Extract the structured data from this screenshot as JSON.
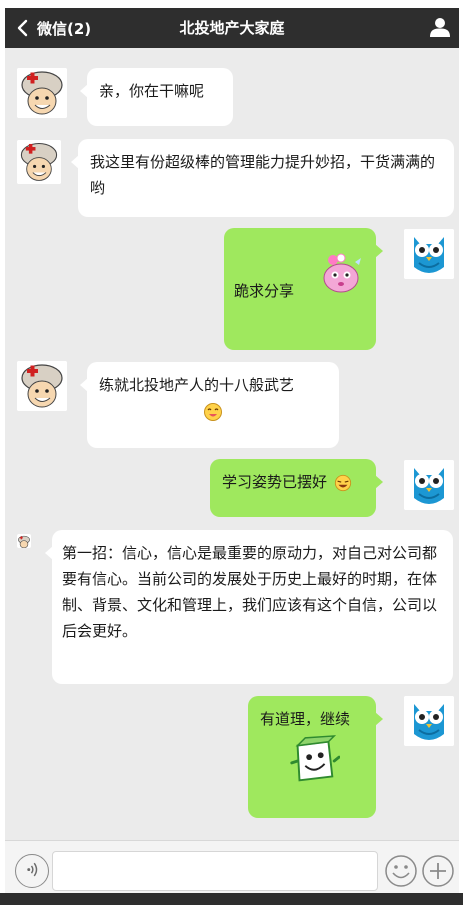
{
  "header": {
    "back_label": "微信(2)",
    "title": "北投地产大家庭"
  },
  "messages": [
    {
      "side": "left",
      "sender": "soldier",
      "text": "亲，你在干嘛呢"
    },
    {
      "side": "left",
      "sender": "soldier",
      "text": "我这里有份超级棒的管理能力提升妙招，干货满满的哟"
    },
    {
      "side": "right",
      "sender": "owl",
      "text": "跪求分享",
      "sticker": "pink-character-sticker"
    },
    {
      "side": "left",
      "sender": "soldier",
      "text": "练就北投地产人的十八般武艺",
      "emoji": "smile-face-emoji"
    },
    {
      "side": "right",
      "sender": "owl",
      "text": "学习姿势已摆好",
      "emoji": "laugh-face-emoji"
    },
    {
      "side": "left",
      "sender": "soldier-small",
      "text": "第一招：信心，信心是最重要的原动力，对自己对公司都要有信心。当前公司的发展处于历史上最好的时期，在体制、背景、文化和管理上，我们应该有这个自信，公司以后会更好。"
    },
    {
      "side": "right",
      "sender": "owl",
      "text": "有道理，继续",
      "sticker": "green-box-sticker"
    }
  ],
  "colors": {
    "header_bg": "#2e2e2e",
    "chat_bg": "#ebebeb",
    "sent_bubble": "#9fe85e",
    "received_bubble": "#ffffff"
  },
  "icons": {
    "back": "chevron-left-icon",
    "profile": "user-icon",
    "voice": "voice-icon",
    "emoji": "emoji-icon",
    "plus": "plus-icon"
  }
}
